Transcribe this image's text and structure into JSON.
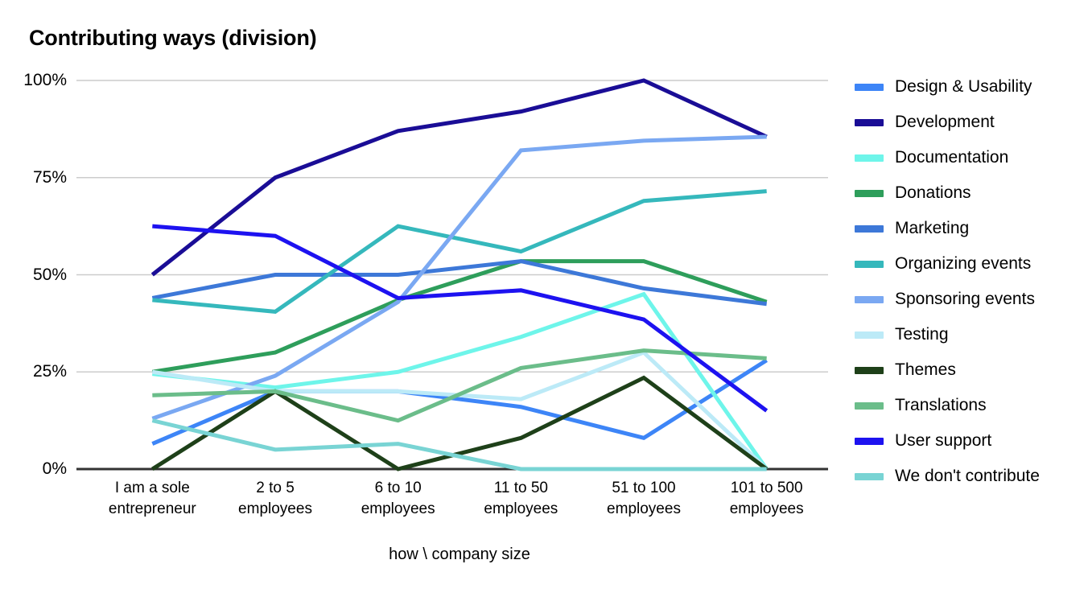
{
  "chart_data": {
    "type": "line",
    "title": "Contributing ways (division)",
    "xlabel": "how \\ company size",
    "ylabel": "",
    "ylim": [
      0,
      100
    ],
    "ytick_labels": [
      "0%",
      "25%",
      "50%",
      "75%",
      "100%"
    ],
    "ytick_values": [
      0,
      25,
      50,
      75,
      100
    ],
    "grid": true,
    "legend_position": "right",
    "categories": [
      "I am a sole entrepreneur",
      "2 to 5 employees",
      "6 to 10 employees",
      "11 to 50 employees",
      "51 to 100 employees",
      "101 to 500 employees"
    ],
    "series": [
      {
        "name": "Design & Usability",
        "color": "#3d85f7",
        "values": [
          6.5,
          20,
          20,
          16,
          8,
          28
        ]
      },
      {
        "name": "Development",
        "color": "#1a0d96",
        "values": [
          50,
          75,
          87,
          92,
          100,
          85.5
        ]
      },
      {
        "name": "Documentation",
        "color": "#6ef5ea",
        "values": [
          24.5,
          21,
          25,
          34,
          45,
          0
        ]
      },
      {
        "name": "Donations",
        "color": "#2e9e5b",
        "values": [
          25,
          30,
          43.5,
          53.5,
          53.5,
          43
        ]
      },
      {
        "name": "Marketing",
        "color": "#3d78d8",
        "values": [
          44,
          50,
          50,
          53.5,
          46.5,
          42.5
        ]
      },
      {
        "name": "Organizing events",
        "color": "#35b8bc",
        "values": [
          43.5,
          40.5,
          62.5,
          56,
          69,
          71.5
        ]
      },
      {
        "name": "Sponsoring events",
        "color": "#7aa8f2",
        "values": [
          13,
          24,
          43,
          82,
          84.5,
          85.5
        ]
      },
      {
        "name": "Testing",
        "color": "#bceaf7",
        "values": [
          25,
          20,
          20,
          18,
          30,
          0
        ]
      },
      {
        "name": "Themes",
        "color": "#1e4019",
        "values": [
          0,
          20,
          0,
          8,
          23.5,
          0
        ]
      },
      {
        "name": "Translations",
        "color": "#6bbd8a",
        "values": [
          19,
          20,
          12.5,
          26,
          30.5,
          28.5
        ]
      },
      {
        "name": "User support",
        "color": "#1d12f0",
        "values": [
          62.5,
          60,
          44,
          46,
          38.5,
          15
        ]
      },
      {
        "name": "We don't contribute",
        "color": "#79d4d4",
        "values": [
          12.5,
          5,
          6.5,
          0,
          0,
          0
        ]
      }
    ]
  },
  "legend": {
    "items": [
      {
        "label": "Design & Usability",
        "color": "#3d85f7"
      },
      {
        "label": "Development",
        "color": "#1a0d96"
      },
      {
        "label": "Documentation",
        "color": "#6ef5ea"
      },
      {
        "label": "Donations",
        "color": "#2e9e5b"
      },
      {
        "label": "Marketing",
        "color": "#3d78d8"
      },
      {
        "label": "Organizing events",
        "color": "#35b8bc"
      },
      {
        "label": "Sponsoring events",
        "color": "#7aa8f2"
      },
      {
        "label": "Testing",
        "color": "#bceaf7"
      },
      {
        "label": "Themes",
        "color": "#1e4019"
      },
      {
        "label": "Translations",
        "color": "#6bbd8a"
      },
      {
        "label": "User support",
        "color": "#1d12f0"
      },
      {
        "label": "We don't contribute",
        "color": "#79d4d4"
      }
    ]
  }
}
